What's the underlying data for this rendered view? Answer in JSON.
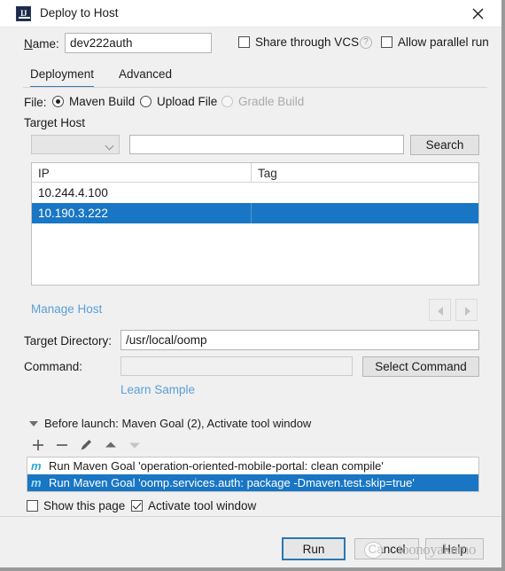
{
  "window": {
    "title": "Deploy to Host",
    "app_icon": "intellij-idea-icon",
    "close_icon": "close-icon"
  },
  "name_row": {
    "label": "Name:",
    "value": "dev222auth",
    "placeholder": "",
    "share_vcs_label": "Share through VCS",
    "share_vcs_checked": false,
    "help_icon": "?",
    "allow_parallel_label": "Allow parallel run",
    "allow_parallel_checked": false
  },
  "tabs": [
    {
      "label": "Deployment",
      "active": true
    },
    {
      "label": "Advanced",
      "active": false
    }
  ],
  "file_row": {
    "label": "File:",
    "options": [
      {
        "label": "Maven Build",
        "selected": true,
        "disabled": false
      },
      {
        "label": "Upload File",
        "selected": false,
        "disabled": false
      },
      {
        "label": "Gradle Build",
        "selected": false,
        "disabled": true
      }
    ]
  },
  "target_host": {
    "section_label": "Target Host",
    "combo_value": "",
    "search_value": "",
    "search_placeholder": "",
    "search_button": "Search",
    "columns": [
      "IP",
      "Tag"
    ],
    "rows": [
      {
        "ip": "10.244.4.100",
        "tag": "",
        "selected": false
      },
      {
        "ip": "10.190.3.222",
        "tag": "",
        "selected": true
      }
    ],
    "manage_host_link": "Manage Host",
    "nav_prev_icon": "chevron-left-icon",
    "nav_next_icon": "chevron-right-icon"
  },
  "deploy_fields": {
    "target_directory_label": "Target Directory:",
    "target_directory_value": "/usr/local/oomp",
    "command_label": "Command:",
    "command_value": "",
    "command_placeholder": "",
    "select_command_button": "Select Command",
    "learn_sample_link": "Learn Sample"
  },
  "before_launch": {
    "header": "Before launch: Maven Goal (2), Activate tool window",
    "caret_icon": "caret-down-icon",
    "toolbar": [
      {
        "icon": "plus-icon",
        "disabled": false
      },
      {
        "icon": "minus-icon",
        "disabled": false
      },
      {
        "icon": "pencil-icon",
        "disabled": false
      },
      {
        "icon": "arrow-up-icon",
        "disabled": false
      },
      {
        "icon": "arrow-down-icon",
        "disabled": true
      }
    ],
    "items": [
      {
        "icon": "maven-icon",
        "label": "Run Maven Goal 'operation-oriented-mobile-portal: clean compile'",
        "selected": false
      },
      {
        "icon": "maven-icon",
        "label": "Run Maven Goal 'oomp.services.auth: package -Dmaven.test.skip=true'",
        "selected": true
      }
    ]
  },
  "bottom": {
    "show_page_label": "Show this page",
    "show_page_checked": false,
    "activate_tool_window_label": "Activate tool window",
    "activate_tool_window_checked": true,
    "run_button": "Run",
    "cancel_button": "Cancel",
    "help_button": "Help",
    "watermark_text": "toonoyakumo"
  },
  "colors": {
    "accent": "#1976c4",
    "tab_underline": "#3d7cb8",
    "link": "#5a9fd6",
    "maven_icon": "#2ea8d6",
    "dialog_bg": "#f0f0f0"
  }
}
